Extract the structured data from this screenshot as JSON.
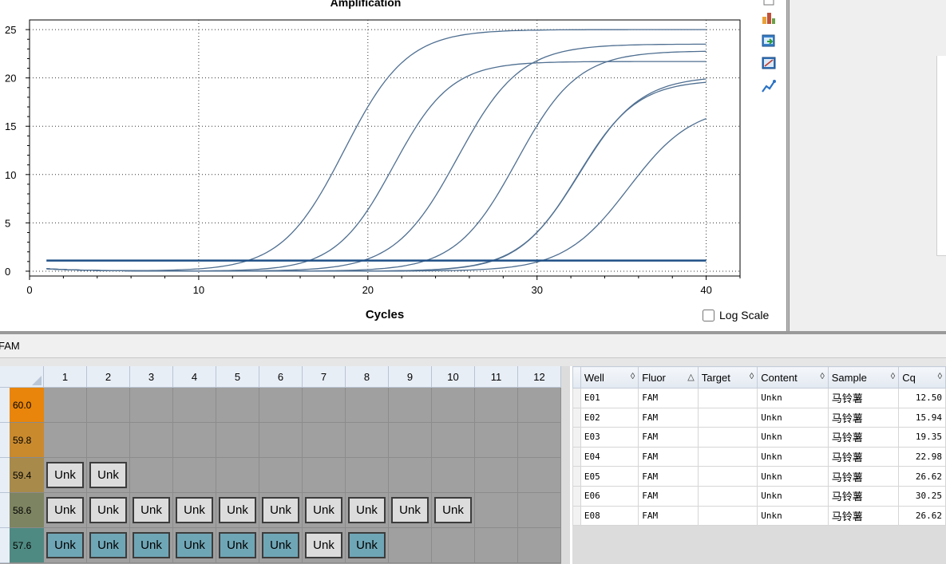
{
  "chart_data": {
    "type": "line",
    "title": "Amplification",
    "xlabel": "Cycles",
    "ylabel": "",
    "xlim": [
      0,
      42
    ],
    "ylim": [
      -0.5,
      26
    ],
    "x_ticks": [
      0,
      10,
      20,
      30,
      40
    ],
    "y_ticks": [
      0,
      5,
      10,
      15,
      20,
      25
    ],
    "grid": true,
    "threshold": 1.1,
    "series": [
      {
        "well": "E01",
        "cq": 12.5,
        "plateau": 25.0,
        "midpoint": 18.6,
        "slope": 1.85,
        "color": "#4f6f91"
      },
      {
        "well": "E02",
        "cq": 15.94,
        "plateau": 21.7,
        "midpoint": 21.5,
        "slope": 1.7,
        "color": "#4f6f91"
      },
      {
        "well": "E03",
        "cq": 19.35,
        "plateau": 23.5,
        "midpoint": 25.3,
        "slope": 1.85,
        "color": "#4f6f91"
      },
      {
        "well": "E04",
        "cq": 22.98,
        "plateau": 22.8,
        "midpoint": 28.8,
        "slope": 1.8,
        "color": "#4f6f91"
      },
      {
        "well": "E05",
        "cq": 26.62,
        "plateau": 20.2,
        "midpoint": 32.5,
        "slope": 1.8,
        "color": "#4f6f91"
      },
      {
        "well": "E06",
        "cq": 30.25,
        "plateau": 17.2,
        "midpoint": 35.4,
        "slope": 1.9,
        "color": "#4f6f91"
      },
      {
        "well": "E08",
        "cq": 26.62,
        "plateau": 19.8,
        "midpoint": 32.4,
        "slope": 1.75,
        "color": "#4f6f91"
      }
    ]
  },
  "chart": {
    "log_scale_label": "Log Scale",
    "log_scale_checked": false,
    "toolbar_icons": [
      "copy-icon",
      "chart-type-icon",
      "export-icon",
      "zoom-icon",
      "baseline-icon"
    ]
  },
  "fluor_bar": {
    "label": "FAM"
  },
  "plate": {
    "columns": [
      "1",
      "2",
      "3",
      "4",
      "5",
      "6",
      "7",
      "8",
      "9",
      "10",
      "11",
      "12"
    ],
    "rows": [
      {
        "temp": "60.0",
        "color": "#e8850a",
        "wells": [
          "",
          "",
          "",
          "",
          "",
          "",
          "",
          "",
          "",
          "",
          "",
          ""
        ]
      },
      {
        "temp": "59.8",
        "color": "#c98a2e",
        "wells": [
          "",
          "",
          "",
          "",
          "",
          "",
          "",
          "",
          "",
          "",
          "",
          ""
        ]
      },
      {
        "temp": "59.4",
        "color": "#a88a4a",
        "wells": [
          "grey",
          "grey",
          "",
          "",
          "",
          "",
          "",
          "",
          "",
          "",
          "",
          ""
        ]
      },
      {
        "temp": "58.6",
        "color": "#7d8461",
        "wells": [
          "grey",
          "grey",
          "grey",
          "grey",
          "grey",
          "grey",
          "grey",
          "grey",
          "grey",
          "grey",
          "",
          ""
        ]
      },
      {
        "temp": "57.6",
        "color": "#4f8a82",
        "wells": [
          "teal",
          "teal",
          "teal",
          "teal",
          "teal",
          "teal",
          "grey",
          "teal",
          "",
          "",
          "",
          ""
        ]
      }
    ],
    "well_label": "Unk"
  },
  "table": {
    "columns": [
      {
        "label": "Well",
        "sort": "◊"
      },
      {
        "label": "Fluor",
        "sort": "△"
      },
      {
        "label": "Target",
        "sort": "◊"
      },
      {
        "label": "Content",
        "sort": "◊"
      },
      {
        "label": "Sample",
        "sort": "◊"
      },
      {
        "label": "Cq",
        "sort": "◊"
      }
    ],
    "rows": [
      {
        "well": "E01",
        "fluor": "FAM",
        "target": "",
        "content": "Unkn",
        "sample": "马铃薯",
        "cq": "12.50"
      },
      {
        "well": "E02",
        "fluor": "FAM",
        "target": "",
        "content": "Unkn",
        "sample": "马铃薯",
        "cq": "15.94"
      },
      {
        "well": "E03",
        "fluor": "FAM",
        "target": "",
        "content": "Unkn",
        "sample": "马铃薯",
        "cq": "19.35"
      },
      {
        "well": "E04",
        "fluor": "FAM",
        "target": "",
        "content": "Unkn",
        "sample": "马铃薯",
        "cq": "22.98"
      },
      {
        "well": "E05",
        "fluor": "FAM",
        "target": "",
        "content": "Unkn",
        "sample": "马铃薯",
        "cq": "26.62"
      },
      {
        "well": "E06",
        "fluor": "FAM",
        "target": "",
        "content": "Unkn",
        "sample": "马铃薯",
        "cq": "30.25"
      },
      {
        "well": "E08",
        "fluor": "FAM",
        "target": "",
        "content": "Unkn",
        "sample": "马铃薯",
        "cq": "26.62"
      }
    ]
  }
}
